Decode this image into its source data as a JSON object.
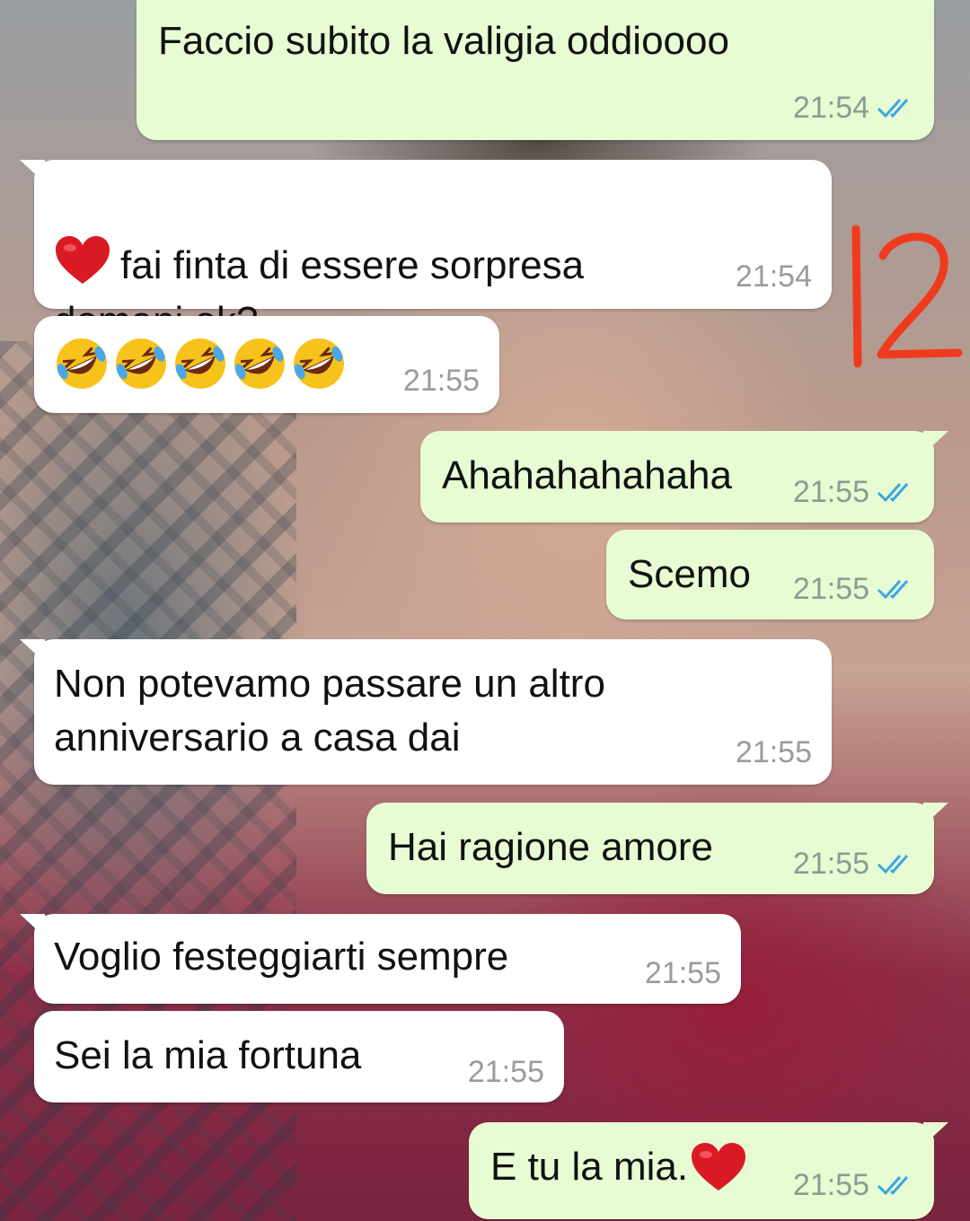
{
  "messages": [
    {
      "id": 1,
      "dir": "out",
      "text": "Faccio subito la valigia oddioooo",
      "time": "21:54",
      "status": "read"
    },
    {
      "id": 2,
      "dir": "in",
      "prefix_emoji": "heart",
      "text": "fai finta di essere sorpresa\ndomani ok?",
      "time": "21:54"
    },
    {
      "id": 3,
      "dir": "in",
      "emoji": "rolling-on-floor-laughing",
      "emoji_count": 5,
      "text": "",
      "time": "21:55"
    },
    {
      "id": 4,
      "dir": "out",
      "text": "Ahahahahahaha",
      "time": "21:55",
      "status": "read"
    },
    {
      "id": 5,
      "dir": "out",
      "text": "Scemo",
      "time": "21:55",
      "status": "read"
    },
    {
      "id": 6,
      "dir": "in",
      "text": "Non potevamo passare un altro\nanniversario a casa dai",
      "time": "21:55"
    },
    {
      "id": 7,
      "dir": "out",
      "text": "Hai ragione amore",
      "time": "21:55",
      "status": "read"
    },
    {
      "id": 8,
      "dir": "in",
      "text": "Voglio festeggiarti sempre",
      "time": "21:55"
    },
    {
      "id": 9,
      "dir": "in",
      "text": "Sei la mia fortuna",
      "time": "21:55"
    },
    {
      "id": 10,
      "dir": "out",
      "text": "E tu la mia.",
      "suffix_emoji": "heart",
      "time": "21:55",
      "status": "read"
    }
  ],
  "annotation": {
    "text": "12",
    "color": "#f03a1e"
  },
  "colors": {
    "incoming_bubble": "#ffffff",
    "outgoing_bubble": "#e7fcd3",
    "read_ticks": "#3ba6e0",
    "timestamp": "#8f9a92",
    "heart": "#d91a24"
  },
  "icons": {
    "read_receipt": "double-check-icon",
    "heart": "heart-emoji",
    "laugh": "rolling-on-floor-laughing-emoji"
  }
}
